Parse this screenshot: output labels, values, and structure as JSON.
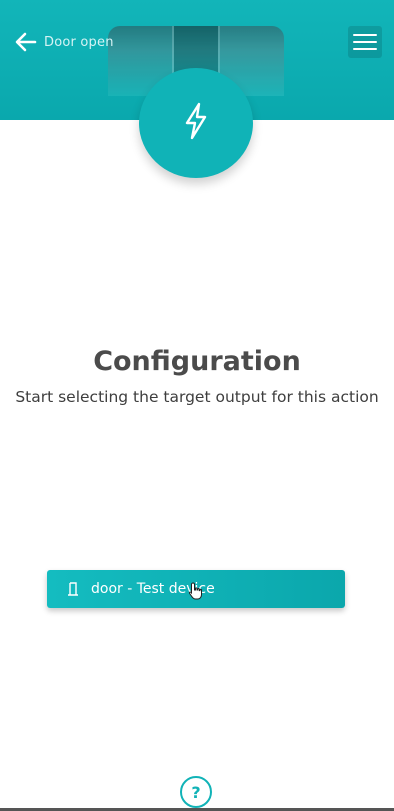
{
  "header": {
    "back_label": "Door open",
    "back_icon": "arrow-left-icon",
    "menu_icon": "hamburger-menu-icon",
    "action_icon": "lightning-bolt-icon",
    "accent_color": "#12b5b9"
  },
  "main": {
    "title": "Configuration",
    "subtitle": "Start selecting the target output for this action"
  },
  "device_button": {
    "label": "door - Test device",
    "icon": "door-icon"
  },
  "footer": {
    "help_label": "?",
    "help_icon": "help-circle-icon"
  }
}
